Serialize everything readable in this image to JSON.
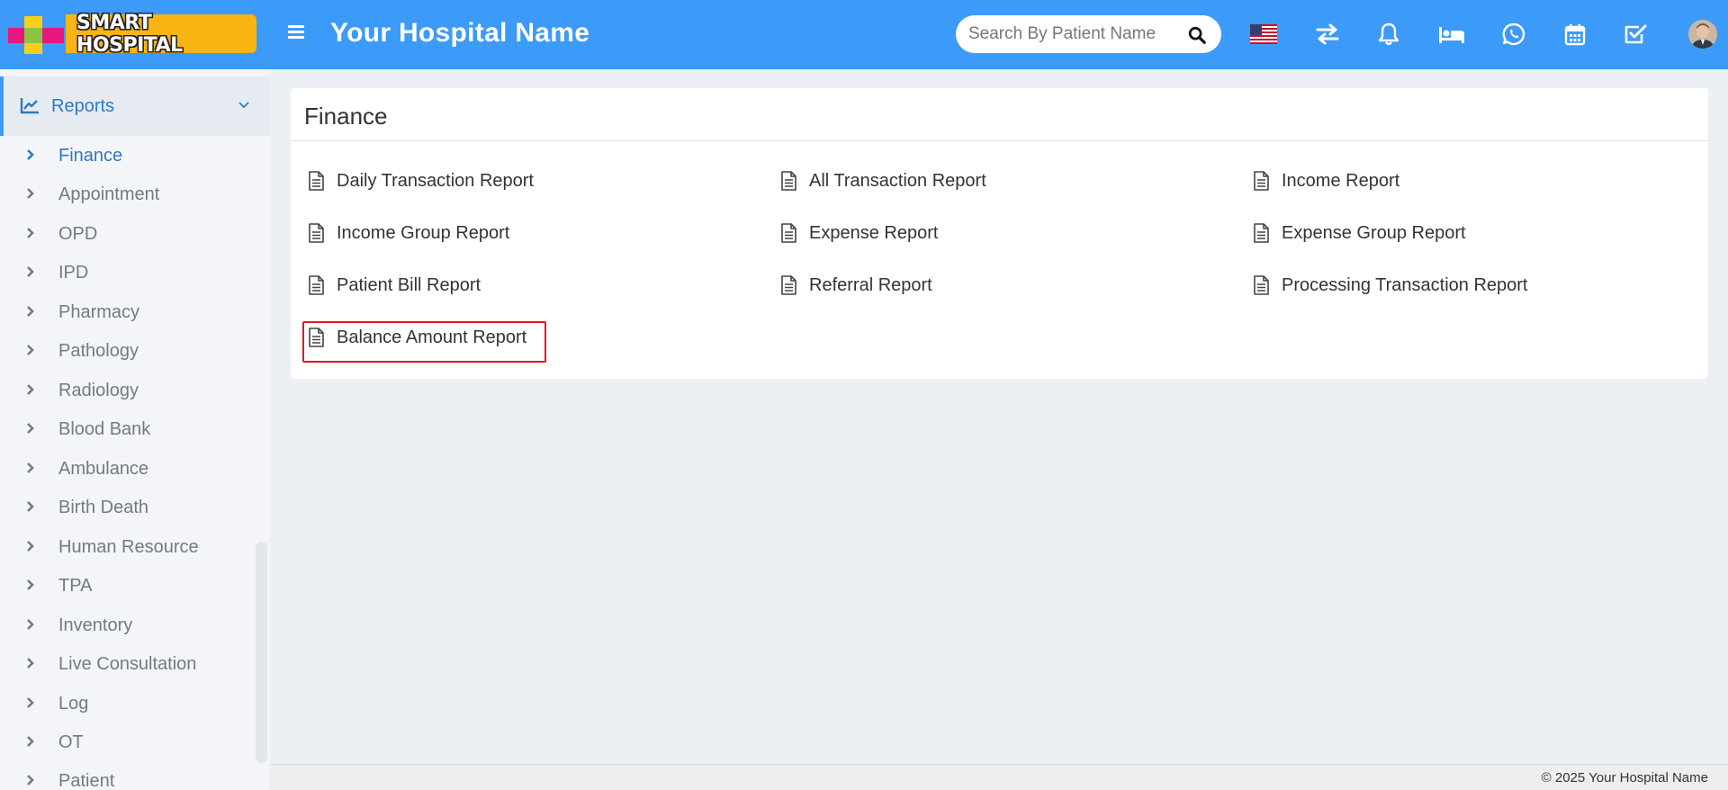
{
  "header": {
    "logo_text": "SMART HOSPITAL",
    "hospital_name": "Your Hospital Name",
    "search_placeholder": "Search By Patient Name",
    "icons": [
      "flag-us-icon",
      "transfer-icon",
      "bell-icon",
      "bed-icon",
      "whatsapp-icon",
      "calendar-icon",
      "task-check-icon",
      "user-avatar"
    ],
    "bg_color": "#3c9af8"
  },
  "sidebar": {
    "section": {
      "label": "Reports",
      "icon": "line-chart-icon"
    },
    "items": [
      {
        "label": "Finance",
        "active": true
      },
      {
        "label": "Appointment"
      },
      {
        "label": "OPD"
      },
      {
        "label": "IPD"
      },
      {
        "label": "Pharmacy"
      },
      {
        "label": "Pathology"
      },
      {
        "label": "Radiology"
      },
      {
        "label": "Blood Bank"
      },
      {
        "label": "Ambulance"
      },
      {
        "label": "Birth Death"
      },
      {
        "label": "Human Resource"
      },
      {
        "label": "TPA"
      },
      {
        "label": "Inventory"
      },
      {
        "label": "Live Consultation"
      },
      {
        "label": "Log"
      },
      {
        "label": "OT"
      },
      {
        "label": "Patient"
      }
    ]
  },
  "main": {
    "title": "Finance",
    "reports": [
      {
        "label": "Daily Transaction Report"
      },
      {
        "label": "All Transaction Report"
      },
      {
        "label": "Income Report"
      },
      {
        "label": "Income Group Report"
      },
      {
        "label": "Expense Report"
      },
      {
        "label": "Expense Group Report"
      },
      {
        "label": "Patient Bill Report"
      },
      {
        "label": "Referral Report"
      },
      {
        "label": "Processing Transaction Report"
      },
      {
        "label": "Balance Amount Report",
        "highlighted": true
      }
    ]
  },
  "footer": {
    "text": "© 2025 Your Hospital Name"
  },
  "colors": {
    "accent": "#3c9af8",
    "active_text": "#2f79c2",
    "highlight_border": "#e6141b"
  }
}
